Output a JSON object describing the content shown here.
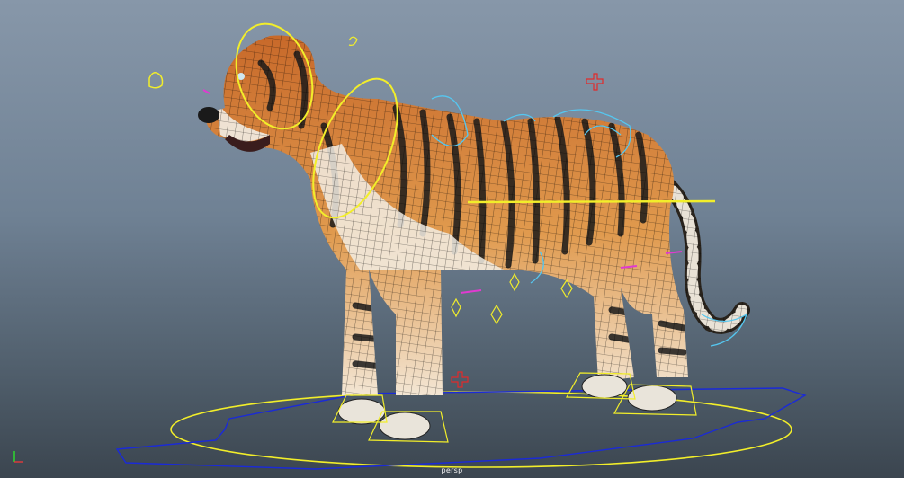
{
  "viewport": {
    "camera_label": "persp",
    "axis_labels": {
      "x": "x",
      "y": "y"
    }
  },
  "scene": {
    "subject": "tiger-rig",
    "colors": {
      "background_top": "#8797a9",
      "background_bottom": "#3b454f",
      "fur": "#d47a2e",
      "stripe": "#1b1b1b",
      "belly": "#f2ede4",
      "wire": "#000000",
      "control_yellow": "#f2ee2a",
      "control_cyan": "#55c7f0",
      "control_blue": "#1a2ad8",
      "control_magenta": "#e03ad0",
      "control_red": "#e22a2a"
    }
  }
}
